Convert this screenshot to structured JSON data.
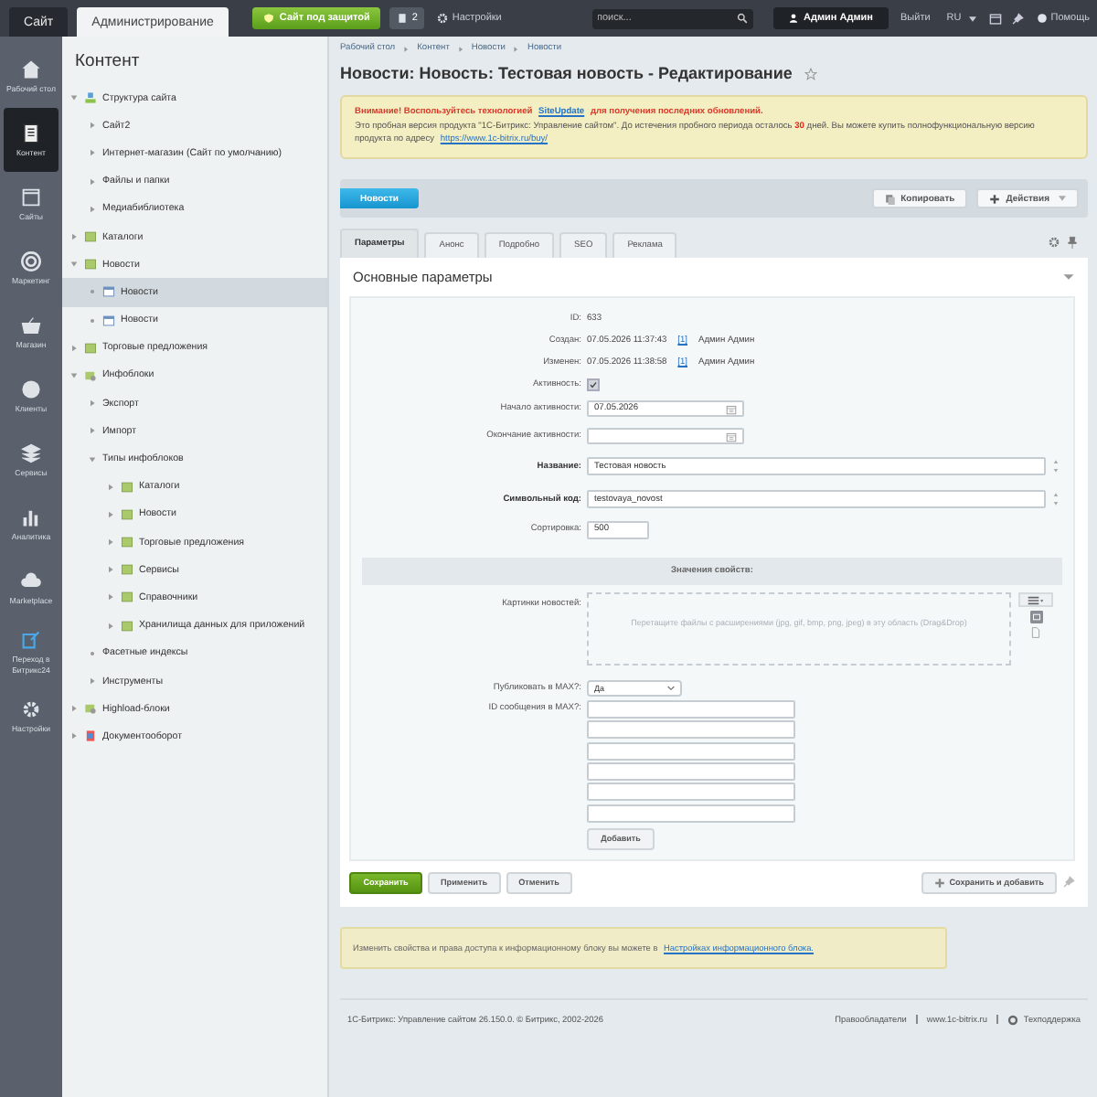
{
  "topbar": {
    "tabs": [
      {
        "label": "Сайт",
        "selected": false
      },
      {
        "label": "Администрирование",
        "selected": true
      }
    ],
    "protect_button": "Сайт под защитой",
    "notifications": "2",
    "settings": "Настройки",
    "search": {
      "placeholder": "поиск..."
    },
    "user": "Админ Админ",
    "logout": "Выйти",
    "language": "RU",
    "help": "Помощь"
  },
  "rail": [
    {
      "label": "Рабочий стол",
      "selected": false
    },
    {
      "label": "Контент",
      "selected": true
    },
    {
      "label": "Сайты",
      "selected": false
    },
    {
      "label": "Маркетинг",
      "selected": false
    },
    {
      "label": "Магазин",
      "selected": false
    },
    {
      "label": "Клиенты",
      "selected": false
    },
    {
      "label": "Сервисы",
      "selected": false
    },
    {
      "label": "Аналитика",
      "selected": false
    },
    {
      "label": "Marketplace",
      "selected": false
    },
    {
      "label": "Переход в Битрикс24",
      "selected": false
    },
    {
      "label": "Настройки",
      "selected": false
    }
  ],
  "tree": {
    "title": "Контент",
    "items": [
      {
        "label": "Структура сайта",
        "kind": "site",
        "expanded": true,
        "selected": false,
        "children": [
          {
            "label": "Сайт2",
            "kind": "plain",
            "expanded": false,
            "selected": false
          },
          {
            "label": "Интернет-магазин (Сайт по умолчанию)",
            "kind": "plain",
            "expanded": false,
            "selected": false
          },
          {
            "label": "Файлы и папки",
            "kind": "plain",
            "expanded": false,
            "selected": false
          },
          {
            "label": "Медиабиблиотека",
            "kind": "plain",
            "expanded": false,
            "selected": false
          }
        ]
      },
      {
        "label": "Каталоги",
        "kind": "type",
        "expanded": false,
        "selected": false
      },
      {
        "label": "Новости",
        "kind": "type",
        "expanded": true,
        "selected": false,
        "children": [
          {
            "label": "Новости",
            "kind": "list",
            "selected": true
          },
          {
            "label": "Новости",
            "kind": "list",
            "selected": false
          }
        ]
      },
      {
        "label": "Торговые предложения",
        "kind": "type",
        "expanded": false,
        "selected": false
      },
      {
        "label": "Инфоблоки",
        "kind": "gear",
        "expanded": true,
        "selected": false,
        "children": [
          {
            "label": "Экспорт",
            "kind": "plain",
            "expanded": false,
            "selected": false
          },
          {
            "label": "Импорт",
            "kind": "plain",
            "expanded": false,
            "selected": false
          },
          {
            "label": "Типы инфоблоков",
            "kind": "plain",
            "expanded": true,
            "selected": false,
            "children": [
              {
                "label": "Каталоги",
                "kind": "type",
                "expanded": false,
                "selected": false
              },
              {
                "label": "Новости",
                "kind": "type",
                "expanded": false,
                "selected": false
              },
              {
                "label": "Торговые предложения",
                "kind": "type",
                "expanded": false,
                "selected": false
              },
              {
                "label": "Сервисы",
                "kind": "type",
                "expanded": false,
                "selected": false
              },
              {
                "label": "Справочники",
                "kind": "type",
                "expanded": false,
                "selected": false
              },
              {
                "label": "Хранилища данных для приложений",
                "kind": "type",
                "expanded": false,
                "selected": false
              }
            ]
          },
          {
            "label": "Фасетные индексы",
            "kind": "plain",
            "selected": false
          },
          {
            "label": "Инструменты",
            "kind": "plain",
            "expanded": false,
            "selected": false
          }
        ]
      },
      {
        "label": "Highload-блоки",
        "kind": "gear",
        "expanded": false,
        "selected": false
      },
      {
        "label": "Документооборот",
        "kind": "docflow",
        "expanded": false,
        "selected": false
      }
    ]
  },
  "breadcrumbs": [
    "Рабочий стол",
    "Контент",
    "Новости",
    "Новости"
  ],
  "title": "Новости: Новость: Тестовая новость - Редактирование",
  "notice": {
    "warning_before": "Внимание! Воспользуйтесь технологией ",
    "warning_link": "SiteUpdate",
    "warning_after": " для получения последних обновлений.",
    "trial_before": "Это пробная версия продукта \"1С-Битрикс: Управление сайтом\". До истечения пробного периода осталось ",
    "trial_days": "30",
    "trial_after": " дней. Вы можете купить полнофункциональную версию продукта по адресу ",
    "trial_link": "https://www.1c-bitrix.ru/buy/"
  },
  "toolbar": {
    "back": "Новости",
    "copy": "Копировать",
    "actions": "Действия"
  },
  "tabs": [
    {
      "label": "Параметры",
      "selected": true
    },
    {
      "label": "Анонс",
      "selected": false
    },
    {
      "label": "Подробно",
      "selected": false
    },
    {
      "label": "SEO",
      "selected": false
    },
    {
      "label": "Реклама",
      "selected": false
    }
  ],
  "section_title": "Основные параметры",
  "form": [
    {
      "kind": "text",
      "label": "ID:",
      "required": false,
      "value": "633"
    },
    {
      "kind": "meta",
      "label": "Создан:",
      "required": false,
      "value": "07.05.2026 11:37:43",
      "link": "[1]",
      "user": "Админ Админ"
    },
    {
      "kind": "meta",
      "label": "Изменен:",
      "required": false,
      "value": "07.05.2026 11:38:58",
      "link": "[1]",
      "user": "Админ Админ"
    },
    {
      "kind": "checkbox",
      "label": "Активность:",
      "required": false,
      "checked": true
    },
    {
      "kind": "date",
      "label": "Начало активности:",
      "required": false,
      "value": "07.05.2026"
    },
    {
      "kind": "date",
      "label": "Окончание активности:",
      "required": false
    },
    {
      "kind": "input",
      "label": "Название:",
      "required": true,
      "value": "Тестовая новость"
    },
    {
      "kind": "input",
      "label": "Символьный код:",
      "required": true,
      "value": "testovaya_novost"
    },
    {
      "kind": "short",
      "label": "Сортировка:",
      "required": false,
      "value": "500"
    },
    {
      "kind": "section",
      "label": "Значения свойств:"
    },
    {
      "kind": "dropzone",
      "label": "Картинки новостей:",
      "required": false,
      "hint": "Перетащите файлы с расширениями (jpg, gif, bmp, png, jpeg) в эту область (Drag&Drop)"
    },
    {
      "kind": "select",
      "label": "Публиковать в MAX?:",
      "required": false,
      "value": "Да"
    },
    {
      "kind": "multi",
      "label": "ID сообщения в MAX?:",
      "required": false,
      "button": "Добавить"
    }
  ],
  "buttons": {
    "save": "Сохранить",
    "apply": "Применить",
    "cancel": "Отменить",
    "save_add": "Сохранить и добавить"
  },
  "info": {
    "before": "Изменить свойства и права доступа к информационному блоку вы можете в ",
    "link": "Настройках информационного блока."
  },
  "footer": {
    "copyright": "1С-Битрикс: Управление сайтом 26.150.0. © Битрикс, 2002-2026",
    "links": [
      "Правообладатели",
      "www.1c-bitrix.ru"
    ],
    "support": "Техподдержка"
  }
}
